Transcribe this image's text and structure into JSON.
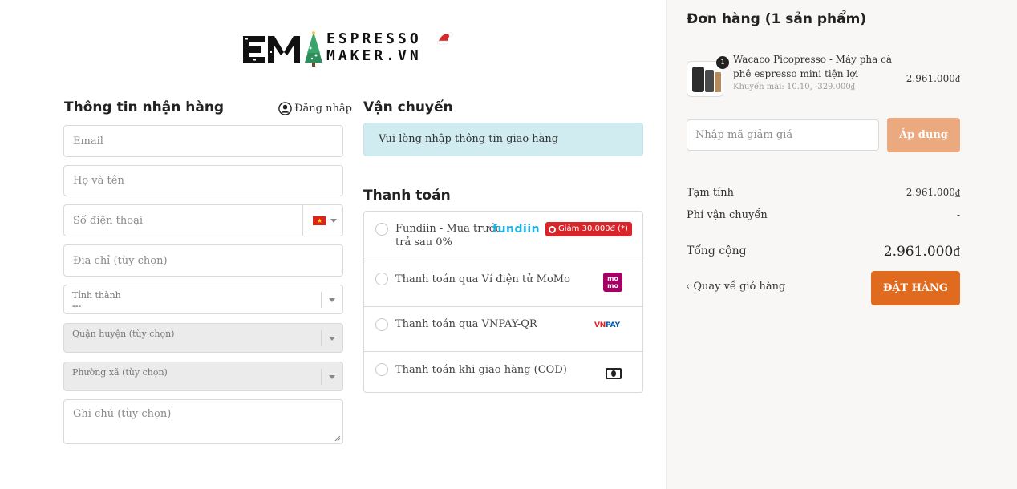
{
  "brand": {
    "logo_line1": "ESPRESSO",
    "logo_line2": "MAKER.VN"
  },
  "colors": {
    "accent_orange": "#e06a1e",
    "apply_button": "#eaa97f",
    "info_bg": "#d1ecf1",
    "sidebar_bg": "#f8f7f6",
    "badge_red": "#d9252a"
  },
  "shipping_info": {
    "title": "Thông tin nhận hàng",
    "login_label": "Đăng nhập",
    "email_placeholder": "Email",
    "name_placeholder": "Họ và tên",
    "phone_placeholder": "Số điện thoại",
    "phone_country_icon": "vietnam-flag-icon",
    "address_placeholder": "Địa chỉ (tùy chọn)",
    "province": {
      "label": "Tỉnh thành",
      "value": "---"
    },
    "district": {
      "label": "Quận huyện (tùy chọn)"
    },
    "ward": {
      "label": "Phường xã (tùy chọn)"
    },
    "note_placeholder": "Ghi chú (tùy chọn)"
  },
  "shipping": {
    "title": "Vận chuyển",
    "message": "Vui lòng nhập thông tin giao hàng"
  },
  "payment": {
    "title": "Thanh toán",
    "methods": [
      {
        "label_line1": "Fundiin - Mua trước",
        "label_line2": "trả sau 0%",
        "logo": "fundiin",
        "badge": "Giảm 30.000đ (*)"
      },
      {
        "label": "Thanh toán qua Ví điện tử MoMo",
        "logo": "momo",
        "logo_text_1": "mo",
        "logo_text_2": "mo"
      },
      {
        "label": "Thanh toán qua VNPAY-QR",
        "logo": "vnpay",
        "logo_text_vn": "VN",
        "logo_text_pay": "PAY"
      },
      {
        "label": "Thanh toán khi giao hàng (COD)",
        "logo": "cash-icon"
      }
    ]
  },
  "order": {
    "title": "Đơn hàng (1 sản phẩm)",
    "item": {
      "quantity": "1",
      "name": "Wacaco Picopresso - Máy pha cà phê espresso mini tiện lợi",
      "discount": "Khuyến mãi: 10.10, -329.000₫",
      "price": "2.961.000₫"
    },
    "coupon_placeholder": "Nhập mã giảm giá",
    "apply_label": "Áp dụng",
    "subtotal_label": "Tạm tính",
    "subtotal_value": "2.961.000₫",
    "shipping_fee_label": "Phí vận chuyển",
    "shipping_fee_value": "-",
    "total_label": "Tổng cộng",
    "total_value": "2.961.000₫",
    "back_label": "‹ Quay về giỏ hàng",
    "order_button": "ĐẶT HÀNG"
  }
}
